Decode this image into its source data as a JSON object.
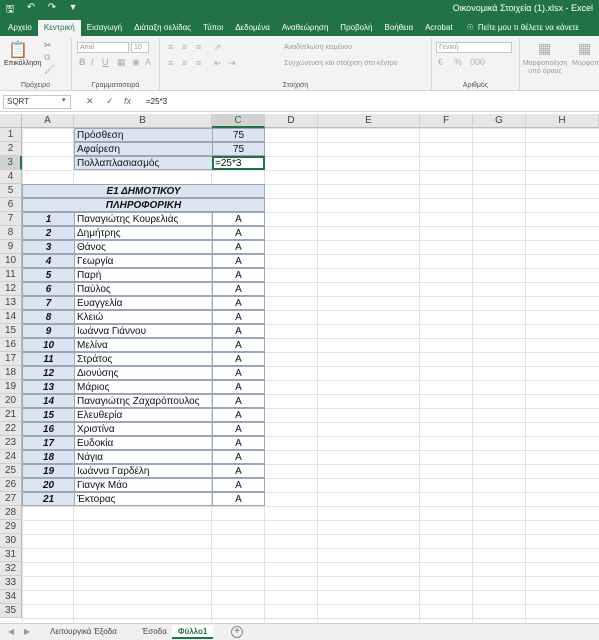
{
  "window": {
    "title": "Οικονομικά Στοιχεία (1).xlsx  -  Excel"
  },
  "ribbon_tabs": [
    {
      "label": "Αρχείο",
      "active": false
    },
    {
      "label": "Κεντρική",
      "active": true
    },
    {
      "label": "Εισαγωγή",
      "active": false
    },
    {
      "label": "Διάταξη σελίδας",
      "active": false
    },
    {
      "label": "Τύποι",
      "active": false
    },
    {
      "label": "Δεδομένα",
      "active": false
    },
    {
      "label": "Αναθεώρηση",
      "active": false
    },
    {
      "label": "Προβολή",
      "active": false
    },
    {
      "label": "Βοήθεια",
      "active": false
    },
    {
      "label": "Acrobat",
      "active": false
    }
  ],
  "tell_me": "Πείτε μου τι θέλετε να κάνετε",
  "ribbon": {
    "paste_label": "Επικόλληση",
    "clipboard_label": "Πρόχειρο",
    "font_name": "Arial",
    "font_size": "10",
    "font_label": "Γραμματοσειρά",
    "wrap_text": "Αναδίπλωση κειμένου",
    "merge_center": "Συγχώνευση και στοίχιση στο κέντρο",
    "alignment_label": "Στοίχιση",
    "number_format": "Γενική",
    "number_label": "Αριθμός",
    "conditional_format": "Μορφοποίηση υπό όρους",
    "format_table": "Μορφοπ"
  },
  "formula_bar": {
    "name_box": "SQRT",
    "cancel": "✕",
    "enter": "✓",
    "fx": "fx",
    "formula": "=25*3"
  },
  "columns": [
    "A",
    "B",
    "C",
    "D",
    "E",
    "F",
    "G",
    "H"
  ],
  "rows": [
    "1",
    "2",
    "3",
    "4",
    "5",
    "6",
    "7",
    "8",
    "9",
    "10",
    "11",
    "12",
    "13",
    "14",
    "15",
    "16",
    "17",
    "18",
    "19",
    "20",
    "21",
    "22",
    "23",
    "24",
    "25",
    "26",
    "27",
    "28",
    "29",
    "30",
    "31",
    "32",
    "33",
    "34",
    "35"
  ],
  "ops_table": [
    {
      "label": "Πρόσθεση",
      "value": "75"
    },
    {
      "label": "Αφαίρεση",
      "value": "75"
    },
    {
      "label": "Πολλαπλασιασμός",
      "value": "=25*3"
    }
  ],
  "class_title": "Ε1 ΔΗΜΟΤΙΚΟΥ",
  "subject_title": "ΠΛΗΡΟΦΟΡΙΚΗ",
  "students": [
    {
      "num": "1",
      "name": "Παναγιώτης Κουρελιάς",
      "grade": "Α"
    },
    {
      "num": "2",
      "name": "Δημήτρης",
      "grade": "Α"
    },
    {
      "num": "3",
      "name": "Θάνος",
      "grade": "Α"
    },
    {
      "num": "4",
      "name": "Γεωργία",
      "grade": "Α"
    },
    {
      "num": "5",
      "name": "Παρή",
      "grade": "Α"
    },
    {
      "num": "6",
      "name": "Παύλος",
      "grade": "Α"
    },
    {
      "num": "7",
      "name": "Ευαγγελία",
      "grade": "Α"
    },
    {
      "num": "8",
      "name": "Κλειώ",
      "grade": "Α"
    },
    {
      "num": "9",
      "name": "Ιωάννα Γιάννου",
      "grade": "Α"
    },
    {
      "num": "10",
      "name": "Μελίνα",
      "grade": "Α"
    },
    {
      "num": "11",
      "name": "Στράτος",
      "grade": "Α"
    },
    {
      "num": "12",
      "name": "Διονύσης",
      "grade": "Α"
    },
    {
      "num": "13",
      "name": "Μάριος",
      "grade": "Α"
    },
    {
      "num": "14",
      "name": "Παναγιώτης Ζαχαρόπουλος",
      "grade": "Α"
    },
    {
      "num": "15",
      "name": "Ελευθερία",
      "grade": "Α"
    },
    {
      "num": "16",
      "name": "Χριστίνα",
      "grade": "Α"
    },
    {
      "num": "17",
      "name": "Ευδοκία",
      "grade": "Α"
    },
    {
      "num": "18",
      "name": "Νάγια",
      "grade": "Α"
    },
    {
      "num": "19",
      "name": "Ιωάννα Γαρδέλη",
      "grade": "Α"
    },
    {
      "num": "20",
      "name": "Γιανγκ Μάο",
      "grade": "Α"
    },
    {
      "num": "21",
      "name": "Έκτορας",
      "grade": "Α"
    }
  ],
  "sheets": [
    {
      "label": "Λειτουργικά Έξοδα",
      "active": false
    },
    {
      "label": "Έσοδα",
      "active": false
    },
    {
      "label": "Φύλλο1",
      "active": true
    }
  ],
  "add_sheet": "+",
  "colors": {
    "brand": "#217346",
    "header_fill": "#dbe5f1"
  }
}
